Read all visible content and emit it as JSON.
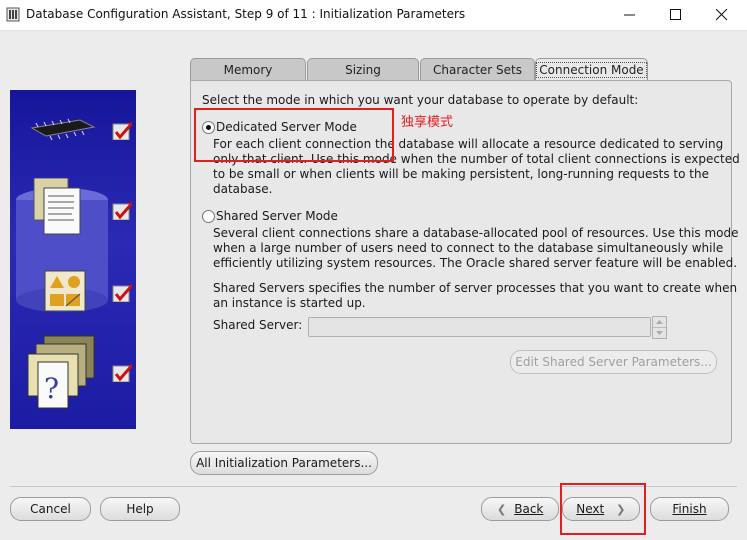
{
  "window": {
    "title": "Database Configuration Assistant, Step 9 of 11 : Initialization Parameters",
    "minimize_icon": "minimize-icon",
    "maximize_icon": "maximize-icon",
    "close_icon": "close-icon"
  },
  "tabs": [
    {
      "label": "Memory"
    },
    {
      "label": "Sizing"
    },
    {
      "label": "Character Sets"
    },
    {
      "label": "Connection Mode"
    }
  ],
  "active_tab": "Connection Mode",
  "main": {
    "intro": "Select the mode in which you want your database to operate by default:",
    "dedicated": {
      "label": "Dedicated Server Mode",
      "selected": true,
      "desc": [
        "For each client connection the database will allocate a resource dedicated to serving",
        "only that client.  Use this mode when the number of total client connections is expected",
        "to be small or when clients will be making persistent, long-running requests to the",
        "database."
      ]
    },
    "annotation": "独享模式",
    "shared": {
      "label": "Shared Server Mode",
      "selected": false,
      "desc": [
        "Several client connections share a database-allocated pool of resources.  Use this mode",
        "when a large number of users need to connect to the database simultaneously while",
        "efficiently utilizing system resources.  The Oracle shared server feature will be enabled."
      ],
      "note": [
        "Shared Servers specifies the number of server processes that you want to create when",
        "an instance is started up."
      ],
      "field_label": "Shared Server:",
      "field_value": "",
      "edit_button": "Edit Shared Server Parameters..."
    },
    "all_params_button": "All Initialization Parameters..."
  },
  "footer": {
    "cancel": "Cancel",
    "help": "Help",
    "back": "Back",
    "next": "Next",
    "finish": "Finish"
  },
  "colors": {
    "side_panel": "#1b1ba3",
    "annotation_red": "#e02020",
    "checkmark_red": "#cc1111"
  },
  "icons": [
    "chip-icon",
    "documents-database-icon",
    "shapes-icon",
    "question-folders-icon",
    "checkbox-checked-icon"
  ]
}
